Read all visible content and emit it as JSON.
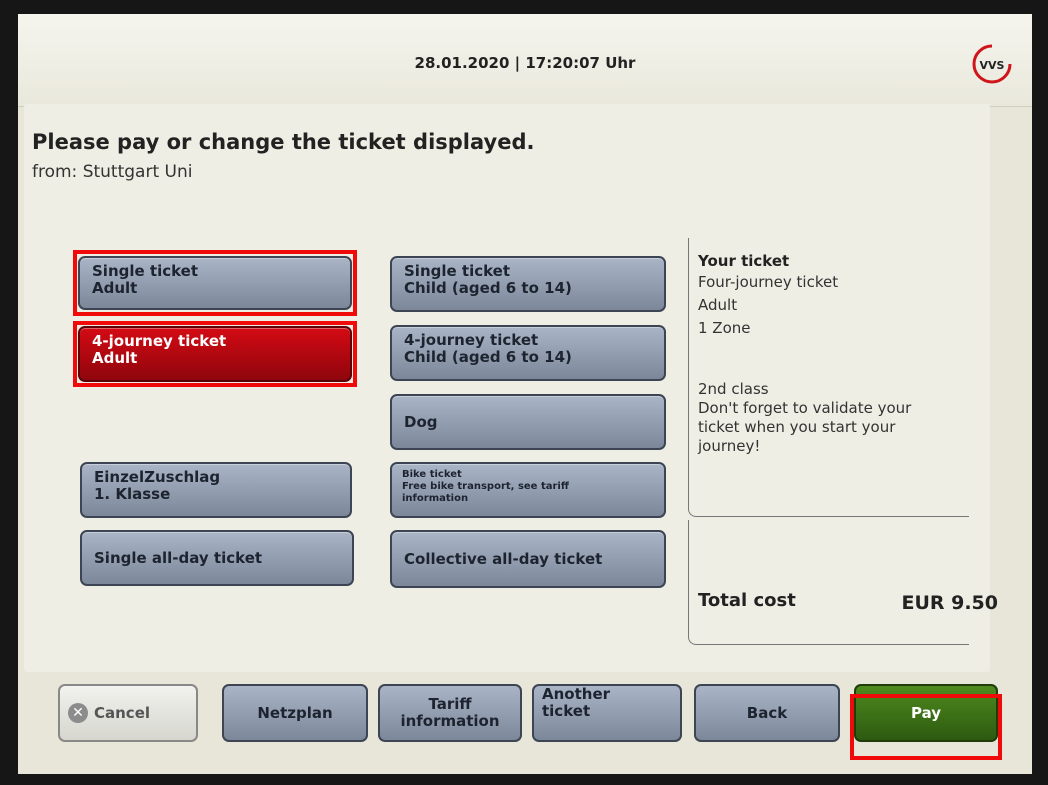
{
  "header": {
    "datetime": "28.01.2020 | 17:20:07 Uhr",
    "logo_text": "VVS"
  },
  "page": {
    "headline": "Please pay or change the ticket displayed.",
    "from": "from: Stuttgart Uni"
  },
  "tickets": {
    "single_adult": {
      "line1": "Single ticket",
      "line2": "Adult"
    },
    "single_child": {
      "line1": "Single ticket",
      "line2": "Child (aged 6 to 14)"
    },
    "four_adult": {
      "line1": "4-journey ticket",
      "line2": "Adult",
      "selected": true
    },
    "four_child": {
      "line1": "4-journey ticket",
      "line2": "Child (aged 6 to 14)"
    },
    "dog": {
      "label": "Dog"
    },
    "einzel": {
      "line1": "EinzelZuschlag",
      "line2": "1. Klasse"
    },
    "bike": {
      "line1": "Bike ticket",
      "line2": "Free bike transport, see tariff",
      "line3": "information"
    },
    "single_allday": {
      "label": "Single all-day ticket"
    },
    "collective_allday": {
      "label": "Collective all-day ticket"
    }
  },
  "summary": {
    "title": "Your ticket",
    "lines": [
      "Four-journey ticket",
      "Adult",
      "1 Zone"
    ],
    "note_lines": [
      "2nd class",
      "Don't forget to validate your",
      "ticket when you start your",
      "journey!"
    ],
    "total_label": "Total cost",
    "total_value": "EUR 9.50"
  },
  "bottom": {
    "cancel": "Cancel",
    "netzplan": "Netzplan",
    "tariff_line1": "Tariff",
    "tariff_line2": "information",
    "another_line1": "Another",
    "another_line2": "ticket",
    "back": "Back",
    "pay": "Pay"
  },
  "colors": {
    "highlight_frame": "#f00a0a",
    "selected_ticket": "#c00812",
    "pay_button": "#3f7418",
    "ticket_button": "#8c97a8"
  }
}
